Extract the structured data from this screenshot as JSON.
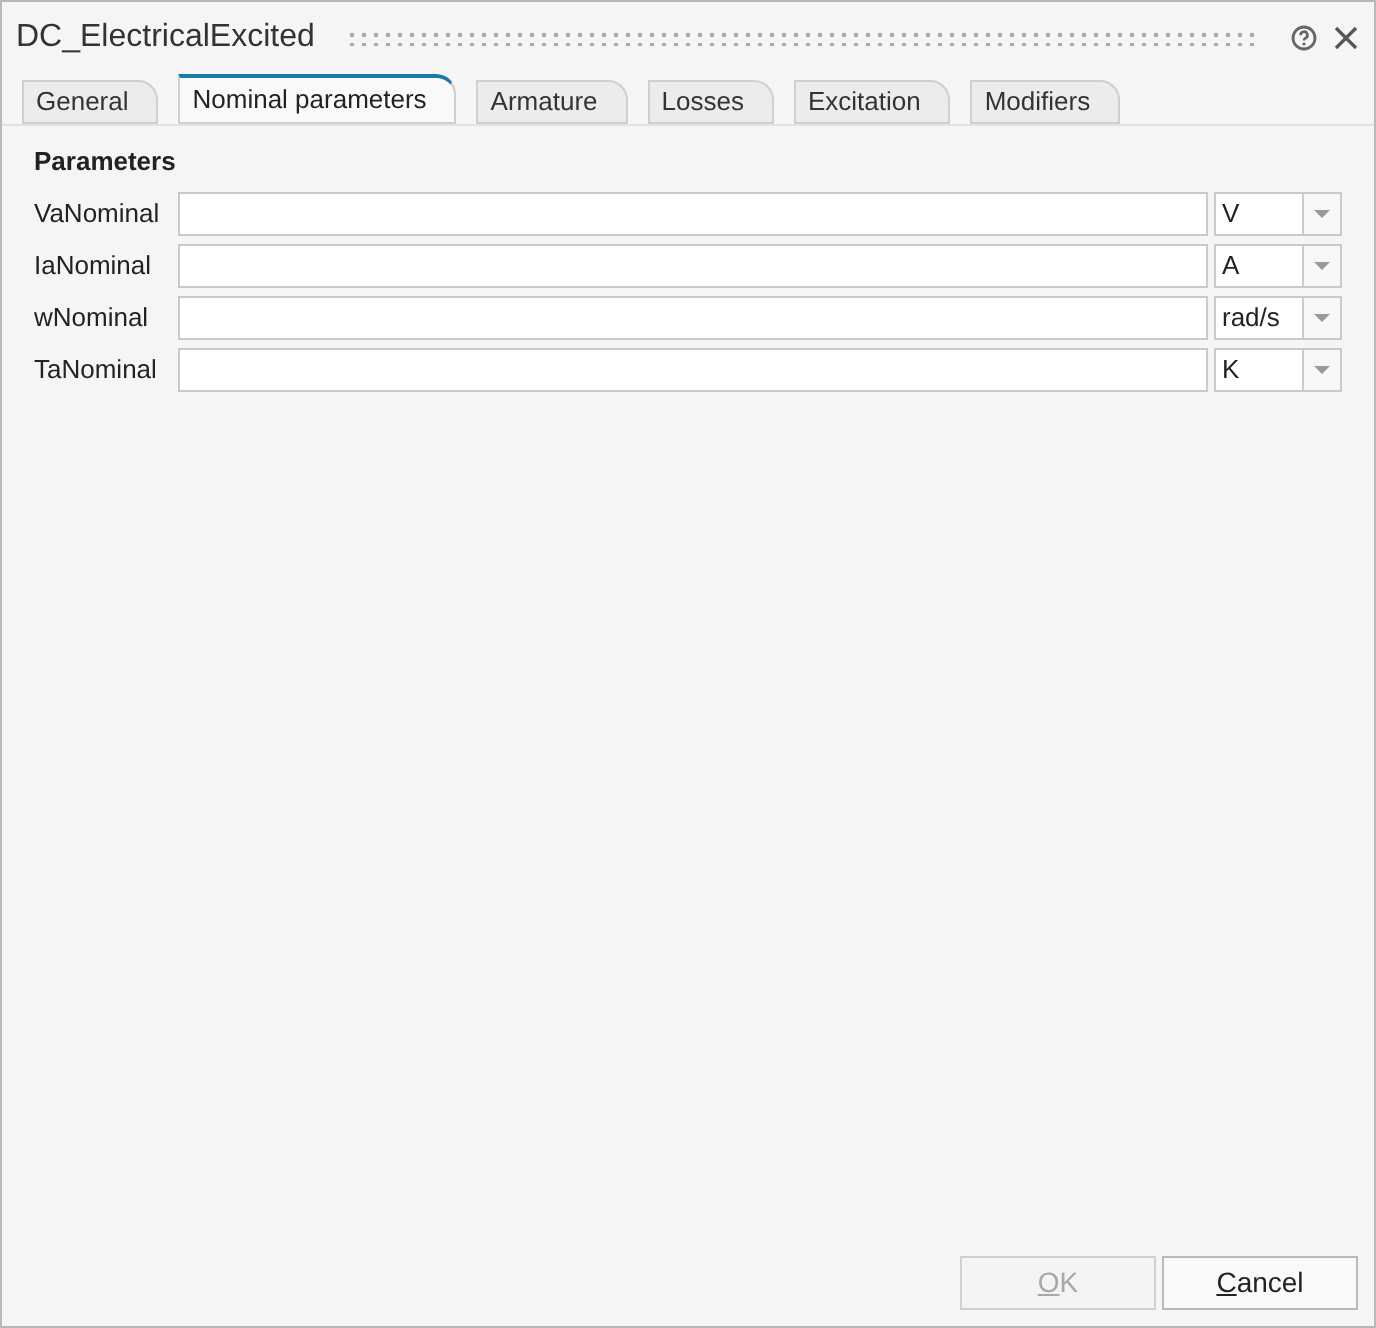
{
  "window": {
    "title": "DC_ElectricalExcited"
  },
  "tabs": [
    {
      "label": "General",
      "selected": false
    },
    {
      "label": "Nominal parameters",
      "selected": true
    },
    {
      "label": "Armature",
      "selected": false
    },
    {
      "label": "Losses",
      "selected": false
    },
    {
      "label": "Excitation",
      "selected": false
    },
    {
      "label": "Modifiers",
      "selected": false
    }
  ],
  "section": {
    "title": "Parameters"
  },
  "parameters": [
    {
      "label": "VaNominal",
      "unit": "V"
    },
    {
      "label": "IaNominal",
      "unit": "A"
    },
    {
      "label": "wNominal",
      "unit": "rad/s"
    },
    {
      "label": "TaNominal",
      "unit": "K"
    }
  ],
  "buttons": [
    {
      "label": "OK",
      "disabled": true,
      "mnemonic_underlined": true
    },
    {
      "label": "Cancel",
      "disabled": false,
      "mnemonic_underlined": true
    }
  ]
}
